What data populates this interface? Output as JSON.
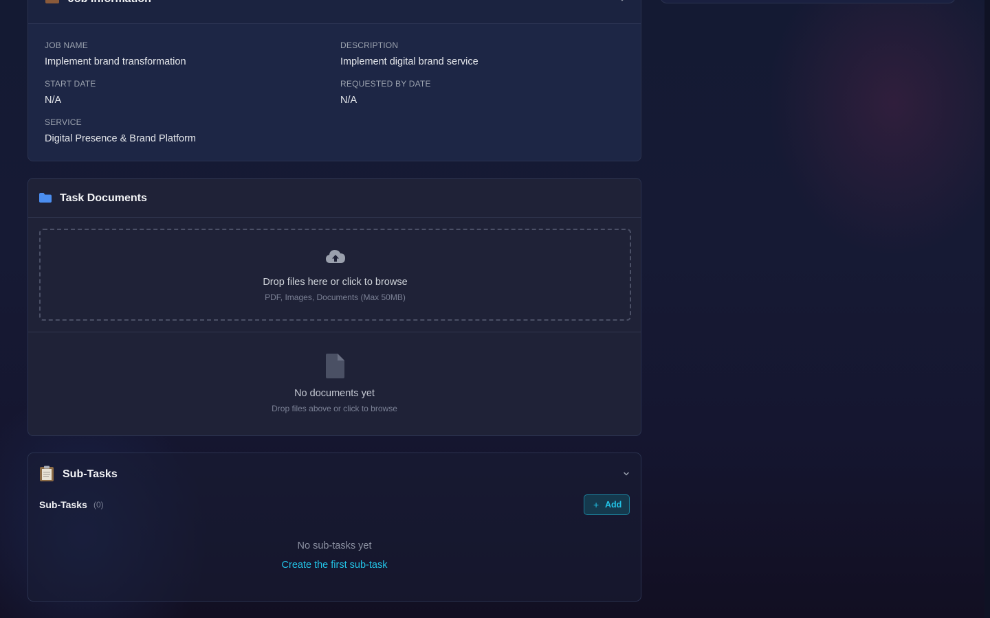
{
  "job_info": {
    "title": "Job Information",
    "fields": {
      "job_name": {
        "label": "JOB NAME",
        "value": "Implement brand transformation"
      },
      "description": {
        "label": "DESCRIPTION",
        "value": "Implement digital brand service"
      },
      "start_date": {
        "label": "START DATE",
        "value": "N/A"
      },
      "requested_by_date": {
        "label": "REQUESTED BY DATE",
        "value": "N/A"
      },
      "service": {
        "label": "SERVICE",
        "value": "Digital Presence & Brand Platform"
      }
    }
  },
  "task_documents": {
    "title": "Task Documents",
    "dropzone": {
      "title": "Drop files here or click to browse",
      "subtitle": "PDF, Images, Documents (Max 50MB)"
    },
    "empty": {
      "title": "No documents yet",
      "subtitle": "Drop files above or click to browse"
    }
  },
  "sub_tasks": {
    "title": "Sub-Tasks",
    "list_label": "Sub-Tasks",
    "count": "(0)",
    "add_label": "Add",
    "empty_text": "No sub-tasks yet",
    "create_link": "Create the first sub-task"
  },
  "icons": {
    "job": "briefcase-icon",
    "docs": "folder-icon",
    "subtasks": "clipboard-icon",
    "upload": "cloud-upload-icon",
    "file": "file-icon",
    "chevron": "chevron-down-icon",
    "add": "plus-icon"
  },
  "colors": {
    "accent": "#22c3e6",
    "folder": "#4b8ef0"
  }
}
